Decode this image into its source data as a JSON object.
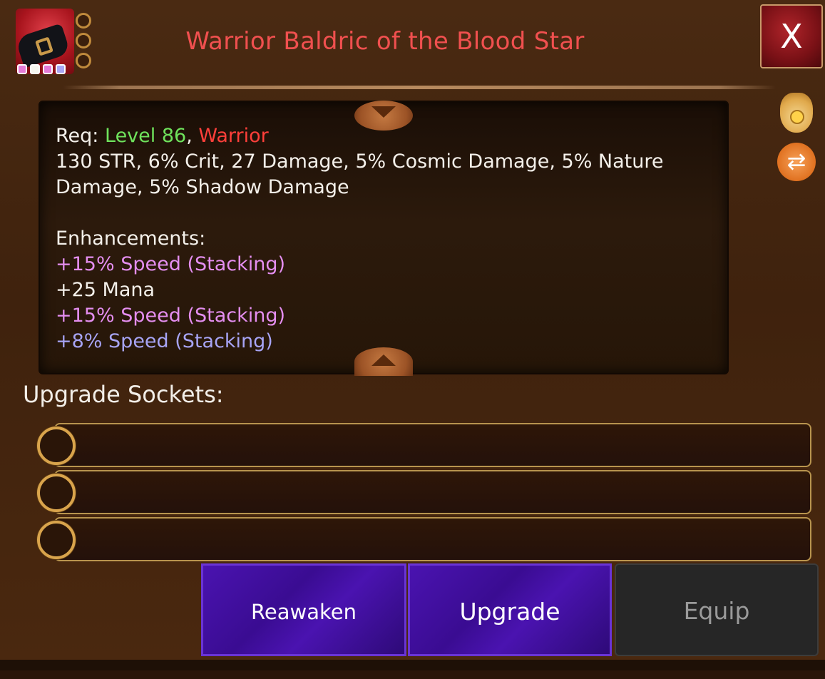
{
  "item": {
    "name": "Warrior Baldric of the Blood Star",
    "icon": "belt-icon",
    "gem_colors": [
      "#e57bd8",
      "#f6f6f0",
      "#e57bd8",
      "#a9a6f4"
    ]
  },
  "close_label": "X",
  "description": {
    "req_label": "Req:",
    "req_level": "Level 86",
    "req_sep": ",",
    "req_class": "Warrior",
    "stats": "130 STR, 6% Crit, 27 Damage, 5% Cosmic Damage, 5% Nature Damage, 5% Shadow Damage",
    "enhancements_label": "Enhancements:",
    "enhancements": [
      {
        "text": "+15% Speed (Stacking)",
        "color": "pink"
      },
      {
        "text": "+25 Mana",
        "color": "white"
      },
      {
        "text": "+15% Speed (Stacking)",
        "color": "pink"
      },
      {
        "text": "+8% Speed (Stacking)",
        "color": "blue"
      }
    ]
  },
  "side_icons": [
    "coin-bag-icon",
    "swap-icon"
  ],
  "upgrade_sockets": {
    "label": "Upgrade Sockets:",
    "count": 3
  },
  "buttons": {
    "reawaken": "Reawaken",
    "upgrade": "Upgrade",
    "equip": "Equip"
  },
  "colors": {
    "title": "#f0504f",
    "level": "#6fe25c",
    "class": "#ff3f3a",
    "pink_stat": "#e48ef0",
    "blue_stat": "#a7a4f5",
    "button_purple": "#3a0c92"
  }
}
